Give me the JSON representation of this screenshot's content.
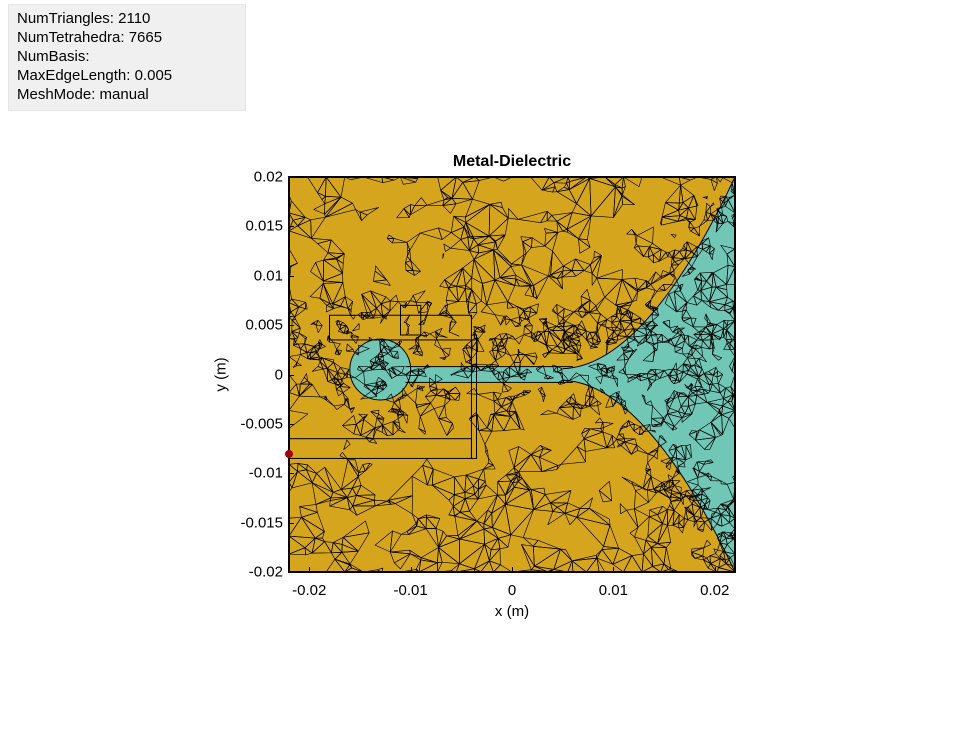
{
  "info": {
    "numTriangles_label": "NumTriangles: ",
    "numTriangles_value": "2110",
    "numTetrahedra_label": "NumTetrahedra: ",
    "numTetrahedra_value": "7665",
    "numBasis_label": "NumBasis:",
    "numBasis_value": "",
    "maxEdgeLength_label": "MaxEdgeLength: ",
    "maxEdgeLength_value": "0.005",
    "meshMode_label": "MeshMode: ",
    "meshMode_value": "manual"
  },
  "chart_data": {
    "type": "heatmap",
    "title": "Metal-Dielectric",
    "xlabel": "x (m)",
    "ylabel": "y (m)",
    "xlim": [
      -0.022,
      0.022
    ],
    "ylim": [
      -0.02,
      0.02
    ],
    "x_ticks": [
      -0.02,
      -0.01,
      0,
      0.01,
      0.02
    ],
    "y_ticks": [
      -0.02,
      -0.015,
      -0.01,
      -0.005,
      0,
      0.005,
      0.01,
      0.015,
      0.02
    ],
    "regions": [
      {
        "name": "metal",
        "color": "#d6a51e"
      },
      {
        "name": "dielectric",
        "color": "#71c7b6"
      }
    ],
    "feed_point": {
      "x": -0.022,
      "y": -0.008
    },
    "mesh": {
      "NumTriangles": 2110,
      "NumTetrahedra": 7665,
      "NumBasis": null,
      "MaxEdgeLength": 0.005,
      "MeshMode": "manual"
    }
  },
  "ticks": {
    "x": [
      {
        "label": "-0.02",
        "val": -0.02
      },
      {
        "label": "-0.01",
        "val": -0.01
      },
      {
        "label": "0",
        "val": 0.0
      },
      {
        "label": "0.01",
        "val": 0.01
      },
      {
        "label": "0.02",
        "val": 0.02
      }
    ],
    "y": [
      {
        "label": "0.02",
        "val": 0.02
      },
      {
        "label": "0.015",
        "val": 0.015
      },
      {
        "label": "0.01",
        "val": 0.01
      },
      {
        "label": "0.005",
        "val": 0.005
      },
      {
        "label": "0",
        "val": 0.0
      },
      {
        "label": "-0.005",
        "val": -0.005
      },
      {
        "label": "-0.01",
        "val": -0.01
      },
      {
        "label": "-0.015",
        "val": -0.015
      },
      {
        "label": "-0.02",
        "val": -0.02
      }
    ]
  }
}
